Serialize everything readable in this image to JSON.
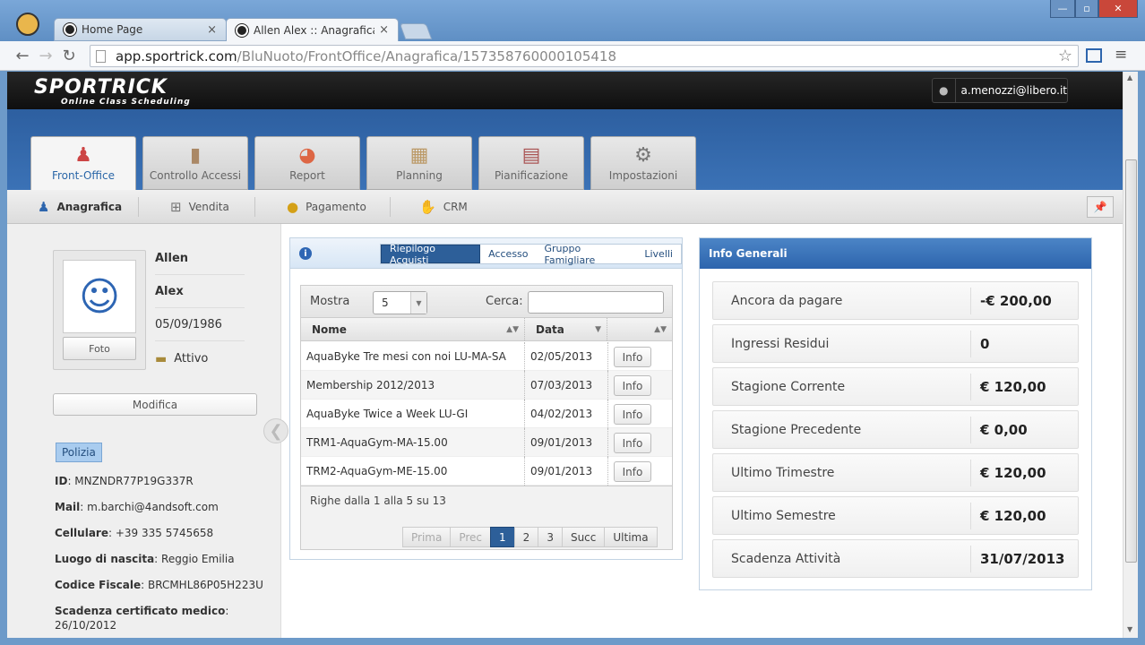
{
  "browser": {
    "tabs": [
      {
        "label": "Home Page"
      },
      {
        "label": "Allen Alex :: Anagrafica :: S"
      }
    ],
    "close_glyph": "×",
    "url_host": "app.sportrick.com",
    "url_path": "/BluNuoto/FrontOffice/Anagrafica/157358760000105418"
  },
  "app": {
    "logo_main": "SPORTRICK",
    "logo_sub": "Online Class Scheduling",
    "user_email": "a.menozzi@libero.it"
  },
  "main_tabs": [
    {
      "label": "Front-Office",
      "icon": "person-icon"
    },
    {
      "label": "Controllo Accessi",
      "icon": "door-icon"
    },
    {
      "label": "Report",
      "icon": "pie-chart-icon"
    },
    {
      "label": "Planning",
      "icon": "grid-icon"
    },
    {
      "label": "Pianificazione",
      "icon": "calendar-icon"
    },
    {
      "label": "Impostazioni",
      "icon": "gear-icon"
    }
  ],
  "sub_tabs": [
    {
      "label": "Anagrafica",
      "icon": "person-icon"
    },
    {
      "label": "Vendita",
      "icon": "cart-icon"
    },
    {
      "label": "Pagamento",
      "icon": "coin-icon"
    },
    {
      "label": "CRM",
      "icon": "handshake-icon"
    }
  ],
  "profile": {
    "first_name": "Allen",
    "last_name": "Alex",
    "birth_date": "05/09/1986",
    "status": "Attivo",
    "foto_label": "Foto",
    "modifica_label": "Modifica",
    "badge": "Polizia",
    "details": [
      {
        "label": "ID",
        "value": ": MNZNDR77P19G337R"
      },
      {
        "label": "Mail",
        "value": ": m.barchi@4andsoft.com"
      },
      {
        "label": "Cellulare",
        "value": ": +39 335 5745658"
      },
      {
        "label": "Luogo di nascita",
        "value": ": Reggio Emilia"
      },
      {
        "label": "Codice Fiscale",
        "value": ": BRCMHL86P05H223U"
      },
      {
        "label": "Scadenza certificato medico",
        "value": ":"
      }
    ],
    "cert_date": "26/10/2012"
  },
  "purchases": {
    "tabs": [
      "Riepilogo Acquisti",
      "Accesso",
      "Gruppo Famigliare",
      "Livelli"
    ],
    "show_label": "Mostra",
    "show_value": "5",
    "search_label": "Cerca:",
    "columns": [
      "Nome",
      "Data"
    ],
    "rows": [
      {
        "nome": "AquaByke Tre mesi con noi LU-MA-SA",
        "data": "02/05/2013",
        "action": "Info"
      },
      {
        "nome": "Membership 2012/2013",
        "data": "07/03/2013",
        "action": "Info"
      },
      {
        "nome": "AquaByke Twice a Week LU-GI",
        "data": "04/02/2013",
        "action": "Info"
      },
      {
        "nome": "TRM1-AquaGym-MA-15.00",
        "data": "09/01/2013",
        "action": "Info"
      },
      {
        "nome": "TRM2-AquaGym-ME-15.00",
        "data": "09/01/2013",
        "action": "Info"
      }
    ],
    "summary": "Righe dalla 1 alla 5 su 13",
    "pager": [
      "Prima",
      "Prec",
      "1",
      "2",
      "3",
      "Succ",
      "Ultima"
    ],
    "current_page": "1"
  },
  "info": {
    "title": "Info Generali",
    "items": [
      {
        "label": "Ancora da pagare",
        "value": "-€ 200,00"
      },
      {
        "label": "Ingressi Residui",
        "value": "0"
      },
      {
        "label": "Stagione Corrente",
        "value": "€ 120,00"
      },
      {
        "label": "Stagione Precedente",
        "value": "€ 0,00"
      },
      {
        "label": "Ultimo Trimestre",
        "value": "€ 120,00"
      },
      {
        "label": "Ultimo Semestre",
        "value": "€ 120,00"
      },
      {
        "label": "Scadenza Attività",
        "value": "31/07/2013"
      }
    ]
  },
  "colors": {
    "brand_blue": "#2d65ad",
    "active_tab_text": "#2b67a8"
  }
}
